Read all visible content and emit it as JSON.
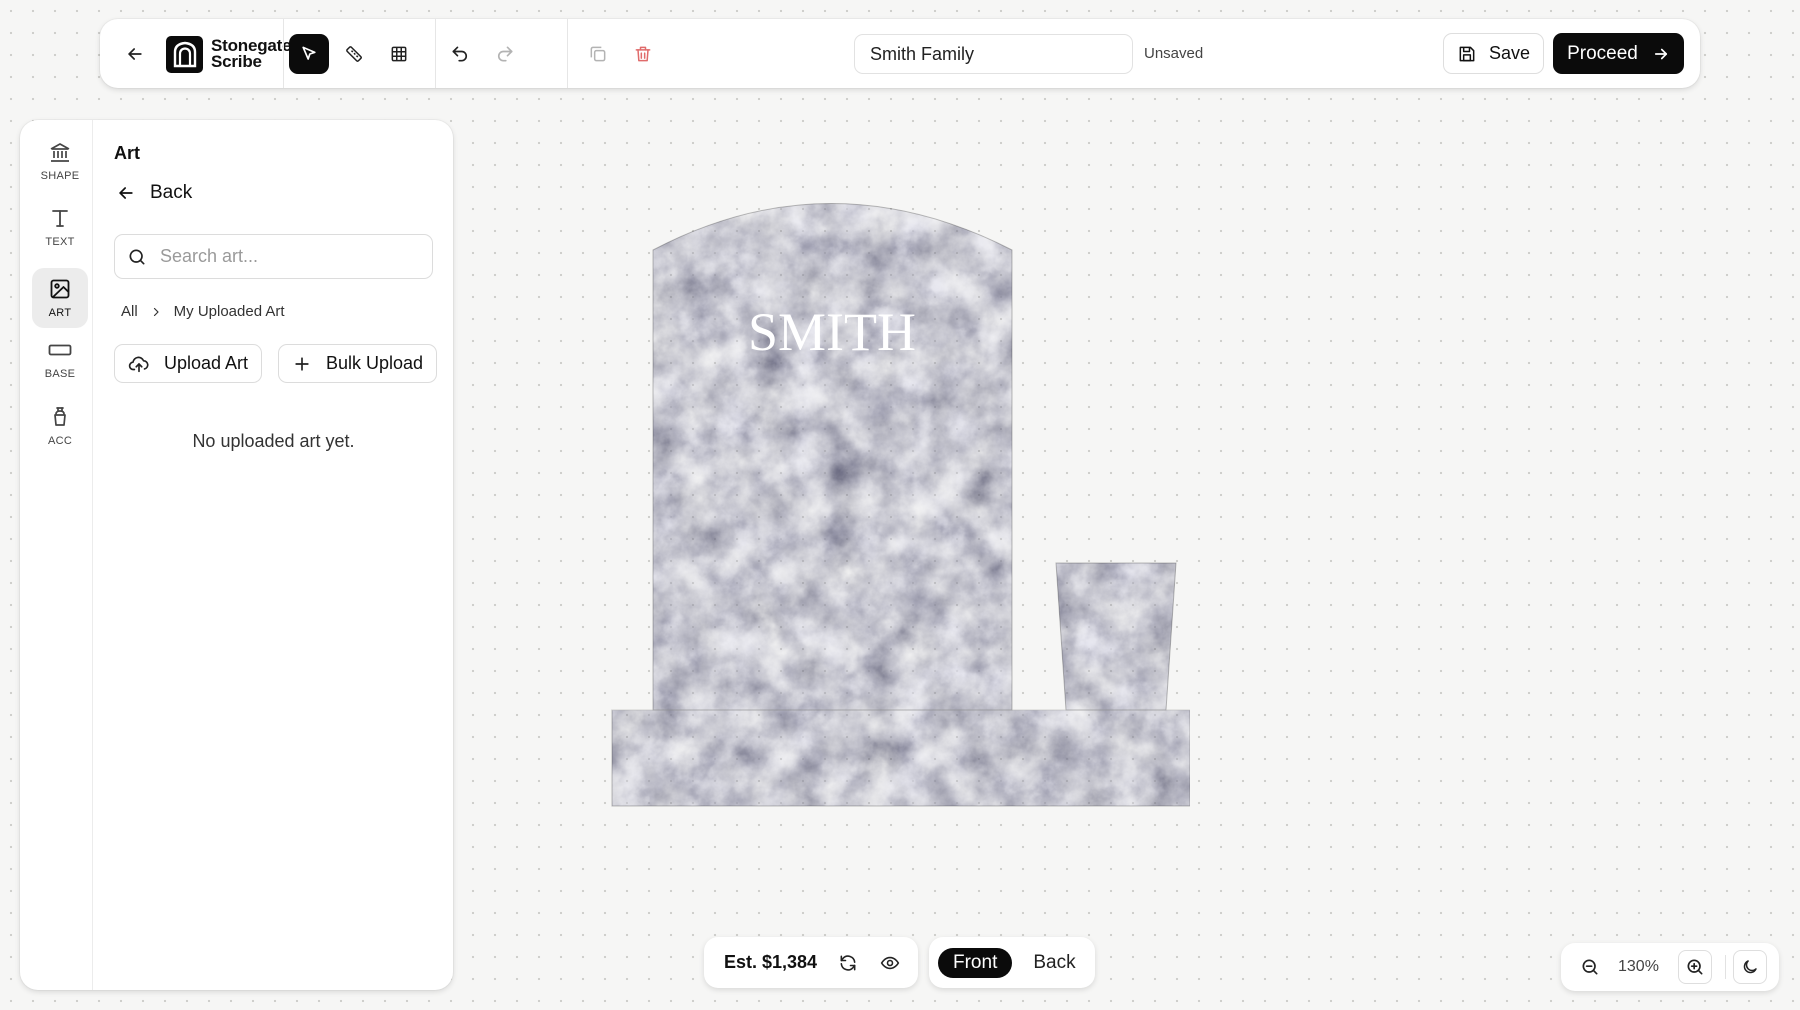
{
  "app": {
    "name_line1": "Stonegate",
    "name_line2": "Scribe"
  },
  "toolbar": {
    "document_name": "Smith Family",
    "save_status": "Unsaved",
    "save_label": "Save",
    "proceed_label": "Proceed",
    "tools": [
      "select-pointer",
      "measure-ruler",
      "grid"
    ],
    "active_tool": "select-pointer"
  },
  "sidebar": {
    "rail": [
      {
        "label": "SHAPE",
        "icon": "monument-icon"
      },
      {
        "label": "TEXT",
        "icon": "text-icon"
      },
      {
        "label": "ART",
        "icon": "image-icon",
        "active": true
      },
      {
        "label": "BASE",
        "icon": "base-icon"
      },
      {
        "label": "ACC",
        "icon": "vase-icon"
      }
    ],
    "panel": {
      "title": "Art",
      "back_label": "Back",
      "search_placeholder": "Search art...",
      "breadcrumb": [
        "All",
        "My Uploaded Art"
      ],
      "upload_label": "Upload Art",
      "bulk_upload_label": "Bulk Upload",
      "empty_message": "No uploaded art yet."
    }
  },
  "canvas": {
    "headstone_inscription": "SMITH",
    "granite_color": "#3a3b4d"
  },
  "footer": {
    "estimate": "Est. $1,384",
    "sides": [
      "Front",
      "Back"
    ],
    "active_side": "Front",
    "zoom": "130%"
  },
  "colors": {
    "accent": "#0b0b0b",
    "danger": "#e06b6b"
  }
}
